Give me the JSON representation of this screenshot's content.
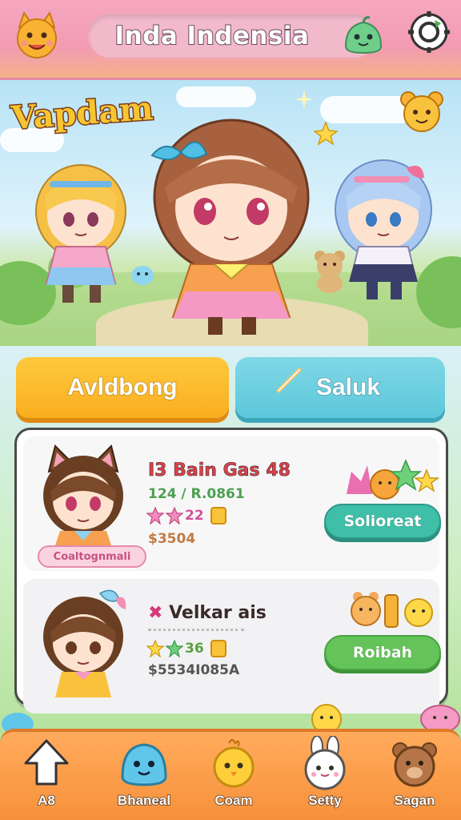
{
  "header": {
    "title": "Inda Indensia",
    "logo_icon": "cat-face-icon",
    "slime_icon": "green-slime-icon",
    "settings_icon": "gear-refresh-icon"
  },
  "hero": {
    "game_logo": "Vapdam"
  },
  "actions": {
    "primary_label": "Avldbong",
    "secondary_label": "Saluk"
  },
  "list": [
    {
      "title": "I3 Bain Gas 48",
      "subtitle": "124 / R.0861",
      "rating_text": "22",
      "stars": 2,
      "price": "$3504",
      "tag": "Coaltognmali",
      "action_label": "Solioreat",
      "action_color": "#3fbfa8"
    },
    {
      "title": "Velkar ais",
      "subtitle": "",
      "rating_text": "36",
      "stars": 2,
      "price": "$5534I085A",
      "tag": "",
      "action_label": "Roibah",
      "action_color": "#64c45a"
    }
  ],
  "nav": [
    {
      "label": "A8",
      "icon": "home-arrow-icon"
    },
    {
      "label": "Bhaneal",
      "icon": "blue-slime-icon"
    },
    {
      "label": "Coam",
      "icon": "yellow-chick-icon"
    },
    {
      "label": "Setty",
      "icon": "white-bunny-icon"
    },
    {
      "label": "Sagan",
      "icon": "brown-bear-icon"
    }
  ],
  "colors": {
    "topbar": "#f29bb3",
    "primary_button": "#f9ae1f",
    "secondary_button": "#5cc7db",
    "nav_bar": "#f7913b"
  }
}
